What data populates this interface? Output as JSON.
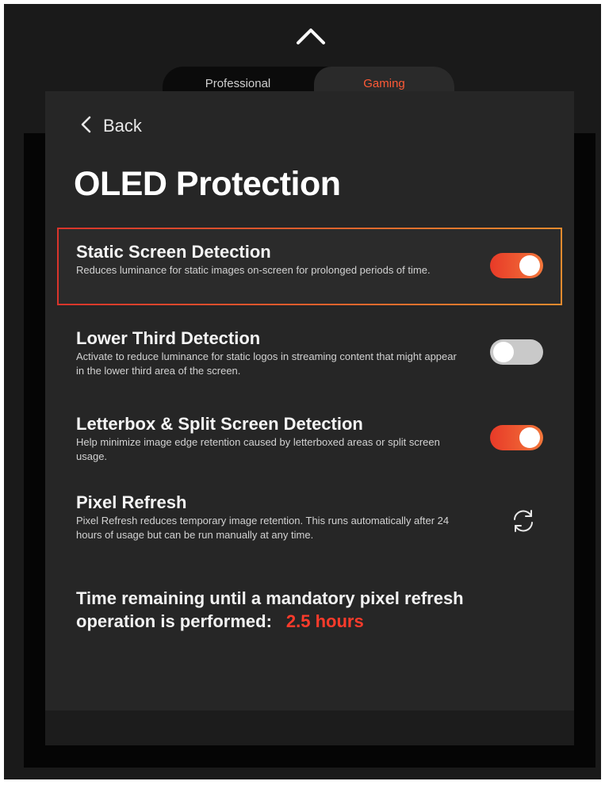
{
  "nav": {
    "collapse_icon": "chevron-up-icon"
  },
  "tabs": [
    {
      "label": "Professional",
      "selected": false
    },
    {
      "label": "Gaming",
      "selected": true
    }
  ],
  "header": {
    "back_label": "Back",
    "back_icon": "chevron-left-icon",
    "title": "OLED Protection"
  },
  "settings": [
    {
      "title": "Static Screen Detection",
      "description": "Reduces luminance for static images on-screen for prolonged periods of time.",
      "enabled": true,
      "focused": true
    },
    {
      "title": "Lower Third Detection",
      "description": "Activate to reduce luminance for static logos in streaming content that might appear in the lower third area of the screen.",
      "enabled": false
    },
    {
      "title": "Letterbox & Split Screen Detection",
      "description": "Help minimize image edge retention caused by letterboxed areas or split screen usage.",
      "enabled": true
    },
    {
      "title": "Pixel Refresh",
      "description": "Pixel Refresh reduces temporary image retention.  This runs automatically after 24 hours of usage but can be run manually at any time.",
      "action_icon": "refresh-icon"
    }
  ],
  "remaining": {
    "text": "Time remaining until a mandatory pixel refresh operation is performed:",
    "value": "2.5 hours"
  },
  "colors": {
    "accent": "#ff3b2b",
    "toggle_on_start": "#e83a28",
    "toggle_on_end": "#f2763a",
    "toggle_off": "#c9c9c9",
    "panel_bg": "#262626"
  }
}
